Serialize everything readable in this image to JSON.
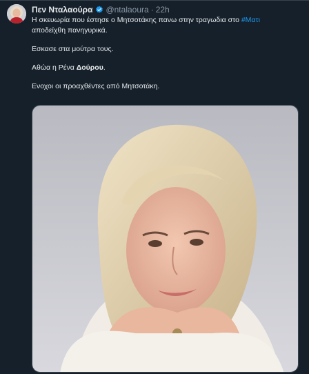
{
  "author": {
    "display_name": "Πεν Νταλαούρα",
    "handle": "@ntalaoura",
    "separator": "·",
    "time": "22h",
    "verified_icon": "verified-badge-icon"
  },
  "tweet": {
    "line1_before_hashtag": "Η σκευωρία που έστησε ο Μητσοτάκης πανω στην τραγωδια στο ",
    "hashtag": "#Ματι",
    "line1_after_hashtag": "αποδείχθη πανηγυρικά.",
    "paragraph2": "Εσκασε στα μούτρα τους.",
    "paragraph3_before_bold": "Αθώα η Ρένα ",
    "paragraph3_bold": "Δούρου",
    "paragraph3_after_bold": ".",
    "paragraph4": "Ενοχοι οι προαχθέντες από Μητσοτάκη."
  },
  "colors": {
    "background": "#15202b",
    "text": "#e7e9ea",
    "muted": "#8b98a5",
    "accent": "#1d9bf0"
  }
}
